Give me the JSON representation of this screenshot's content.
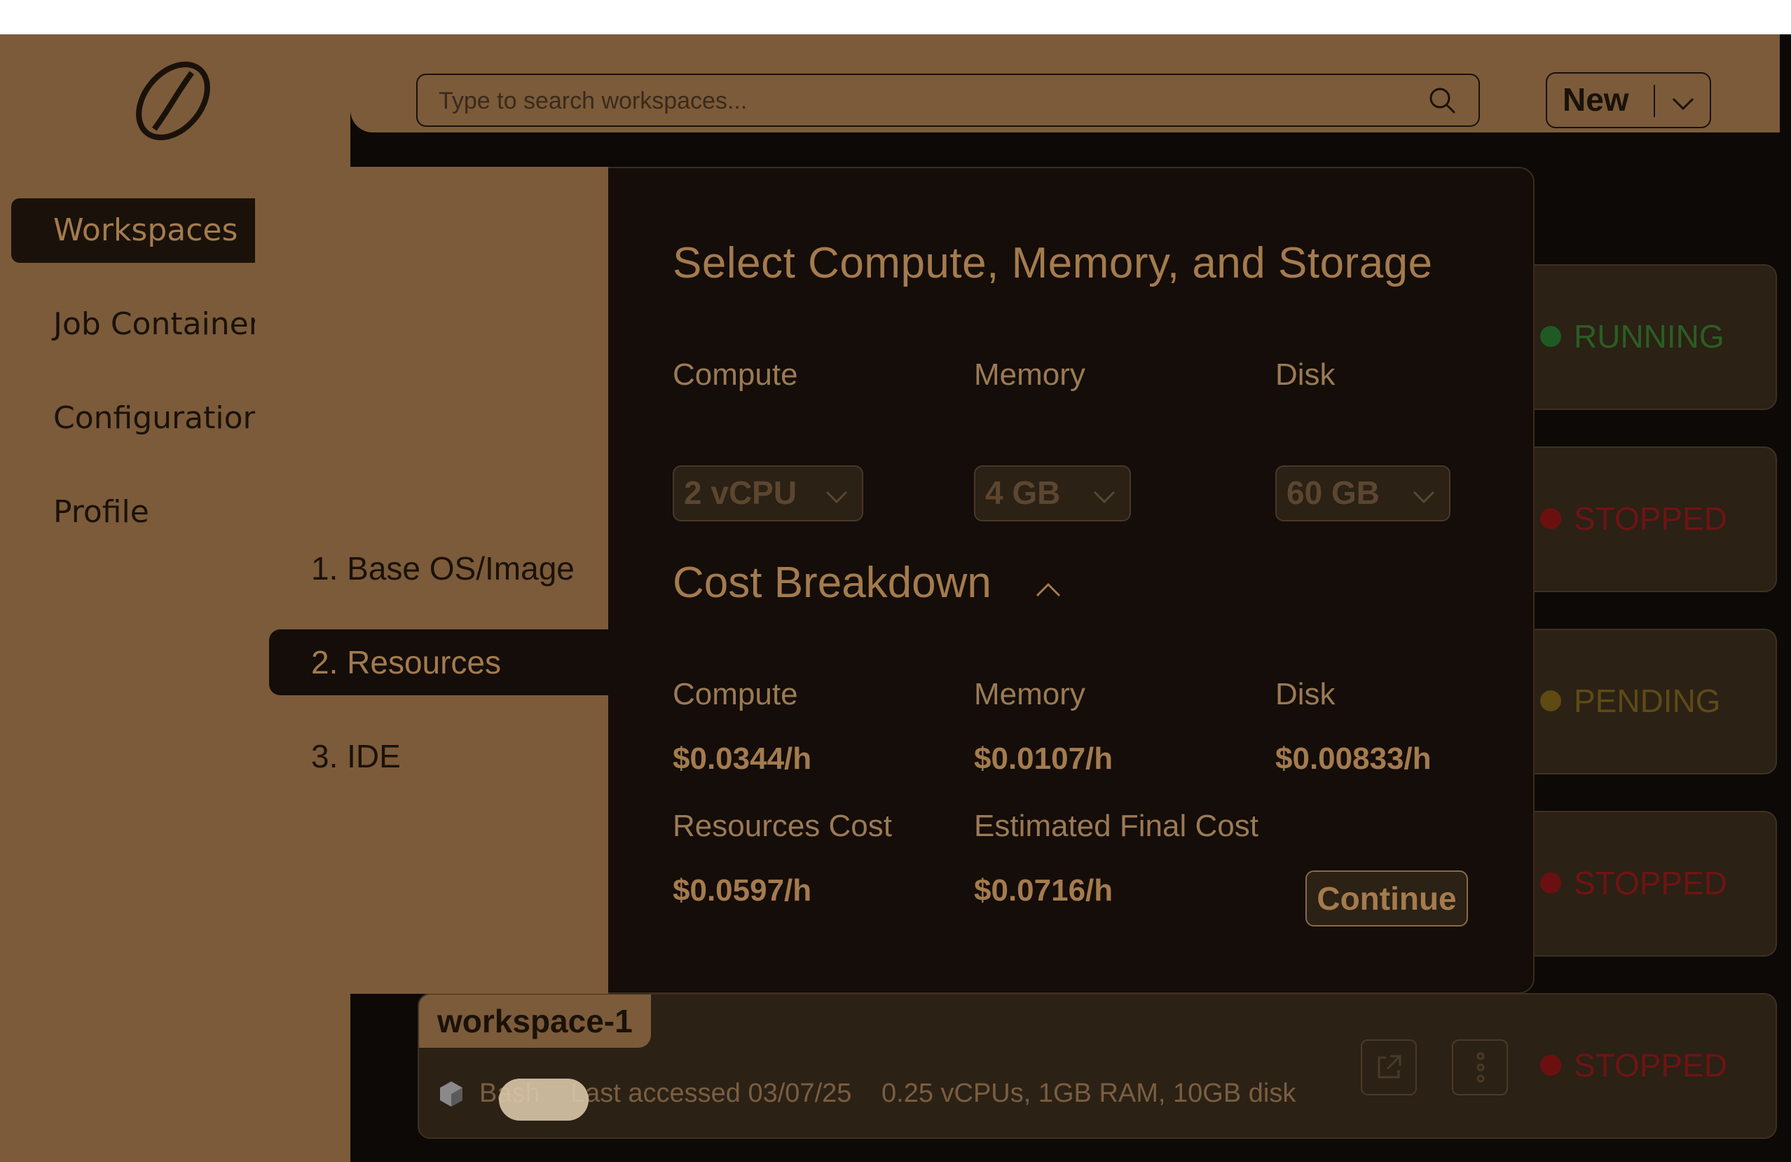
{
  "sidebar": {
    "items": [
      {
        "label": "Workspaces"
      },
      {
        "label": "Job Containers"
      },
      {
        "label": "Configurations"
      },
      {
        "label": "Profile"
      }
    ]
  },
  "topbar": {
    "search_placeholder": "Type to search workspaces...",
    "new_label": "New"
  },
  "workspaces": {
    "statuses": [
      "RUNNING",
      "STOPPED",
      "PENDING",
      "STOPPED",
      "STOPPED"
    ],
    "status_colors": {
      "RUNNING": "#1f6b2a",
      "STOPPED": "#7a1414",
      "PENDING": "#6b5414"
    },
    "visible": {
      "name": "workspace-1",
      "shell": "Bash",
      "last_accessed": "Last accessed 03/07/25",
      "specs": "0.25 vCPUs, 1GB RAM, 10GB disk"
    }
  },
  "modal": {
    "steps": [
      {
        "label": "1. Base OS/Image"
      },
      {
        "label": "2. Resources"
      },
      {
        "label": "3. IDE"
      }
    ],
    "title": "Select Compute, Memory, and Storage",
    "fields": [
      {
        "label": "Compute",
        "value": "2 vCPU"
      },
      {
        "label": "Memory",
        "value": "4 GB"
      },
      {
        "label": "Disk",
        "value": "60 GB"
      }
    ],
    "cost_title": "Cost Breakdown",
    "cost_items": [
      {
        "label": "Compute",
        "value": "$0.0344/h"
      },
      {
        "label": "Memory",
        "value": "$0.0107/h"
      },
      {
        "label": "Disk",
        "value": "$0.00833/h"
      }
    ],
    "totals": [
      {
        "label": "Resources Cost",
        "value": "$0.0597/h"
      },
      {
        "label": "Estimated Final Cost",
        "value": "$0.0716/h"
      }
    ],
    "continue_label": "Continue"
  },
  "colors": {
    "accent": "#a47b4e",
    "sidebar_bg": "#7c5b3a",
    "modal_bg": "#140d09"
  }
}
